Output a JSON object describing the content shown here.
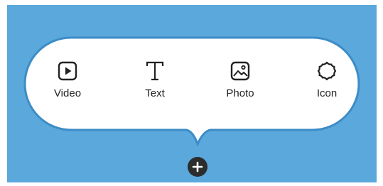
{
  "colors": {
    "background": "#5aa8dc",
    "bubble_fill": "#ffffff",
    "bubble_border": "#3d8cc6",
    "icon_color": "#222222",
    "add_button": "#2c2c2c"
  },
  "menu": {
    "items": [
      {
        "label": "Video",
        "icon": "play-square-icon"
      },
      {
        "label": "Text",
        "icon": "text-t-icon"
      },
      {
        "label": "Photo",
        "icon": "image-icon"
      },
      {
        "label": "Icon",
        "icon": "badge-icon"
      }
    ]
  },
  "add_button": {
    "icon": "plus-icon"
  }
}
